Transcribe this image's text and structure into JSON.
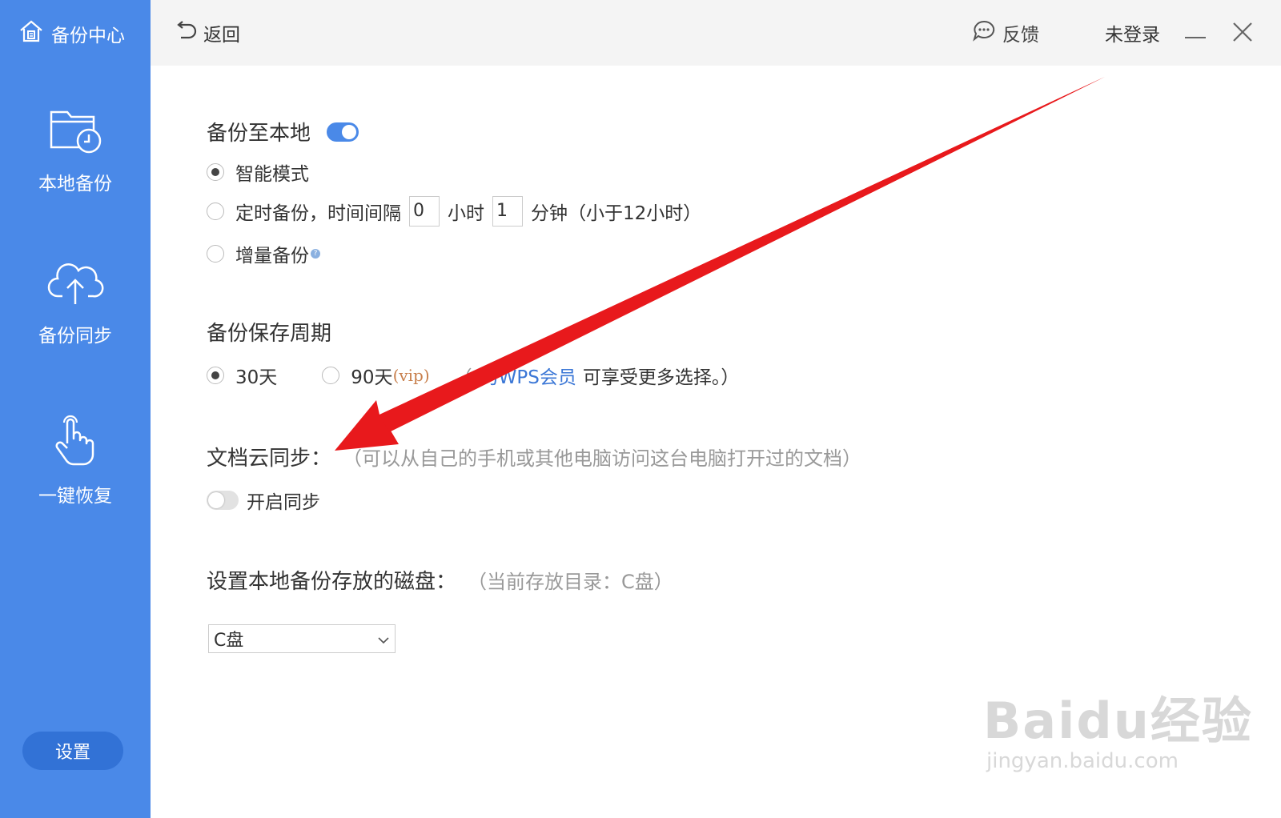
{
  "sidebar": {
    "brand": "备份中心",
    "items": [
      {
        "label": "本地备份",
        "icon": "folder-clock-icon"
      },
      {
        "label": "备份同步",
        "icon": "cloud-upload-icon"
      },
      {
        "label": "一键恢复",
        "icon": "hand-pointer-icon"
      }
    ],
    "settings": "设置"
  },
  "header": {
    "back": "返回",
    "feedback": "反馈",
    "login": "未登录"
  },
  "backup_local": {
    "title": "备份至本地",
    "toggle_on": true,
    "smart_mode": "智能模式",
    "timed_prefix": "定时备份，时间间隔",
    "hours_value": "0",
    "hours_unit": "小时",
    "minutes_value": "1",
    "minutes_unit": "分钟（小于12小时）",
    "incremental": "增量备份"
  },
  "retention": {
    "title": "备份保存周期",
    "opt30": "30天",
    "opt90": "90天",
    "vip": "(vip)",
    "hint_open": "（",
    "hint_partial": "为",
    "member_link": "WPS会员",
    "hint_rest": "可享受更多选择。）"
  },
  "cloud_sync": {
    "title": "文档云同步：",
    "hint": "（可以从自己的手机或其他电脑访问这台电脑打开过的文档）",
    "toggle_label": "开启同步",
    "toggle_on": false
  },
  "disk": {
    "title": "设置本地备份存放的磁盘：",
    "hint": "（当前存放目录：C盘）",
    "selected": "C盘"
  },
  "watermark": {
    "main": "Baidu经验",
    "sub": "jingyan.baidu.com"
  },
  "colors": {
    "sidebar": "#4a89e8",
    "accent": "#3b77d6",
    "arrow": "#e8191c"
  }
}
